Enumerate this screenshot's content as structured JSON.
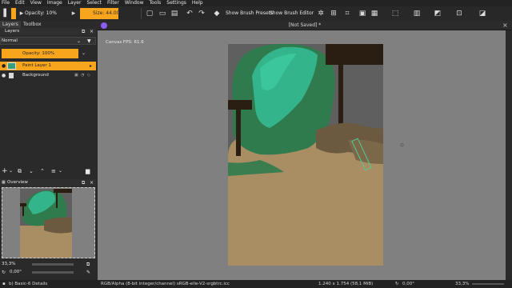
{
  "menu": [
    "File",
    "Edit",
    "View",
    "Image",
    "Layer",
    "Select",
    "Filter",
    "Window",
    "Tools",
    "Settings",
    "Help"
  ],
  "toolbar": {
    "opacity_label": "Opacity: 10%",
    "size_label": "Size: 44.00 px",
    "show_brush_presets": "Show Brush Presets",
    "show_brush_editor": "Show Brush Editor"
  },
  "document": {
    "title": "[Not Saved]  *"
  },
  "left_dock": {
    "tabs": [
      "Layers",
      "Toolbox"
    ],
    "section_title": "Layers",
    "blend_mode": "Normal",
    "opacity_label": "Opacity:  100%",
    "layers": [
      {
        "name": "Paint Layer 1",
        "active": true
      },
      {
        "name": "Background",
        "active": false
      }
    ],
    "overview_title": "Overview",
    "zoom_value": "33,3%",
    "rotation_value": "0,00°"
  },
  "canvas": {
    "fps_label": "Canvas FPS: 61.6"
  },
  "status": {
    "brush": "b) Basic-6 Details",
    "color_info": "RGB/Alpha (8-bit integer/channel)  sRGB-elle-V2-srgbtrc.icc",
    "dimensions": "1.240 x 1.754 (58,1 MiB)",
    "rotation": "0,00°",
    "zoom": "33,3%"
  },
  "colors": {
    "accent": "#f7a51d",
    "canvas_bg": "#808080",
    "paint_tan": "#a98e63",
    "paint_green": "#2f7b4d",
    "paint_teal": "#34b48a",
    "paint_dark": "#2a1d12",
    "paint_grey": "#5f5f5f"
  }
}
